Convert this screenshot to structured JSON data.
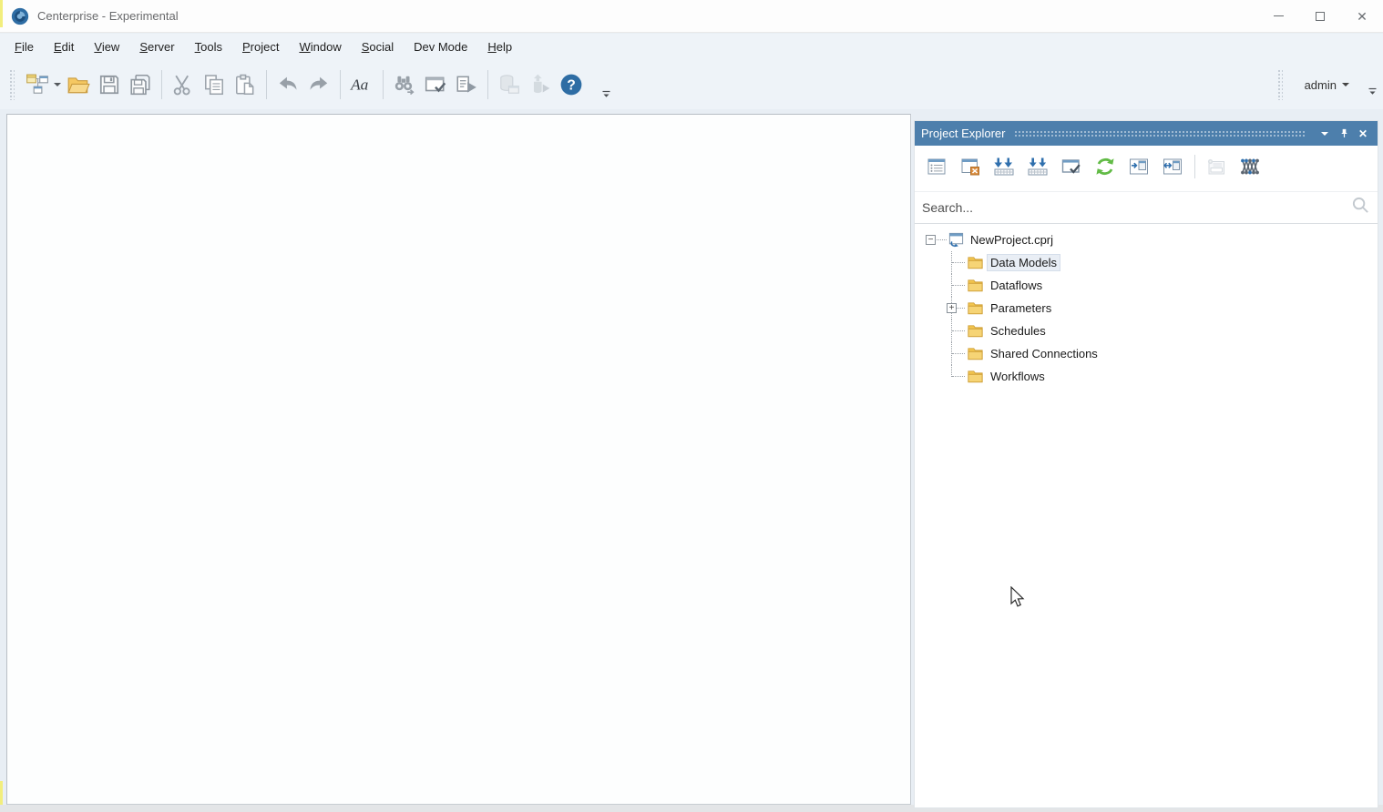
{
  "window": {
    "title": "Centerprise - Experimental",
    "controls": [
      {
        "name": "minimize",
        "glyph": "minimize-icon"
      },
      {
        "name": "maximize",
        "glyph": "maximize-icon"
      },
      {
        "name": "close",
        "glyph": "close-icon"
      }
    ]
  },
  "menubar": {
    "items": [
      {
        "label": "File",
        "accel": 0
      },
      {
        "label": "Edit",
        "accel": 0
      },
      {
        "label": "View",
        "accel": 0
      },
      {
        "label": "Server",
        "accel": 0
      },
      {
        "label": "Tools",
        "accel": 0
      },
      {
        "label": "Project",
        "accel": 0
      },
      {
        "label": "Window",
        "accel": 0
      },
      {
        "label": "Social",
        "accel": 0
      },
      {
        "label": "Dev Mode",
        "accel": -1
      },
      {
        "label": "Help",
        "accel": 0
      }
    ]
  },
  "toolbar": {
    "groups": [
      {
        "buttons": [
          {
            "icon": "new-project-icon",
            "dropdown": true
          },
          {
            "icon": "open-folder-icon"
          },
          {
            "icon": "save-icon"
          },
          {
            "icon": "save-all-icon"
          }
        ]
      },
      {
        "buttons": [
          {
            "icon": "cut-icon"
          },
          {
            "icon": "copy-icon"
          },
          {
            "icon": "paste-icon"
          }
        ]
      },
      {
        "buttons": [
          {
            "icon": "undo-icon"
          },
          {
            "icon": "redo-icon"
          }
        ]
      },
      {
        "buttons": [
          {
            "icon": "font-icon"
          }
        ]
      },
      {
        "buttons": [
          {
            "icon": "find-icon"
          },
          {
            "icon": "verify-window-icon"
          },
          {
            "icon": "run-document-icon"
          }
        ]
      },
      {
        "buttons": [
          {
            "icon": "database-icon",
            "disabled": true
          },
          {
            "icon": "deploy-icon",
            "disabled": true
          },
          {
            "icon": "help-icon"
          }
        ]
      }
    ]
  },
  "account": {
    "name": "admin"
  },
  "project_explorer": {
    "title": "Project Explorer",
    "header_buttons": [
      {
        "icon": "chevron-down-icon"
      },
      {
        "icon": "pin-icon"
      },
      {
        "icon": "close-icon"
      }
    ],
    "toolbar": [
      {
        "icon": "list-details-icon"
      },
      {
        "icon": "close-project-icon"
      },
      {
        "icon": "get-latest-icon"
      },
      {
        "icon": "get-latest-all-icon"
      },
      {
        "icon": "verify-project-icon"
      },
      {
        "icon": "refresh-icon"
      },
      {
        "icon": "dock-panel-icon"
      },
      {
        "icon": "dock-panel-alt-icon"
      },
      {
        "sep": true
      },
      {
        "icon": "project-options-icon",
        "disabled": true
      },
      {
        "icon": "lineage-icon"
      }
    ],
    "search": {
      "placeholder": "Search..."
    },
    "tree": {
      "root": {
        "label": "NewProject.cprj",
        "icon": "project-icon",
        "expander": "minus"
      },
      "items": [
        {
          "label": "Data Models",
          "icon": "folder-icon",
          "selected": true
        },
        {
          "label": "Dataflows",
          "icon": "folder-icon"
        },
        {
          "label": "Parameters",
          "icon": "folder-icon",
          "expander": "plus"
        },
        {
          "label": "Schedules",
          "icon": "folder-icon"
        },
        {
          "label": "Shared Connections",
          "icon": "folder-icon"
        },
        {
          "label": "Workflows",
          "icon": "folder-icon"
        }
      ]
    }
  },
  "colors": {
    "panel_header_blue": "#4d7fac",
    "accent_blue": "#2e6da4",
    "window_blue": "#6f9cc4",
    "folder_yellow": "#f3c64f",
    "refresh_green": "#62bb46",
    "toolbar_bg": "#eef3f8",
    "main_bg": "#e8eef4",
    "selection_bg": "#e9eef5"
  }
}
